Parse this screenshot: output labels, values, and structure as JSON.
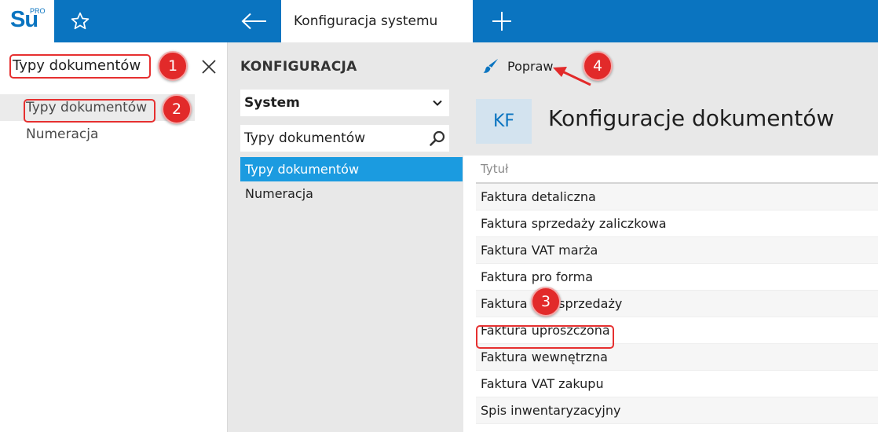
{
  "app": {
    "logo_text": "Su",
    "logo_sup": "PRO",
    "tab_title": "Konfiguracja systemu"
  },
  "search": {
    "value": "Typy dokumentów",
    "results": [
      {
        "label": "Typy dokumentów",
        "selected": true
      },
      {
        "label": "Numeracja",
        "selected": false
      }
    ]
  },
  "config": {
    "section_title": "KONFIGURACJA",
    "select_value": "System",
    "filter_value": "Typy dokumentów",
    "nav_items": [
      {
        "label": "Typy dokumentów",
        "active": true
      },
      {
        "label": "Numeracja",
        "active": false
      }
    ]
  },
  "main": {
    "edit_button_label": "Popraw",
    "badge": "KF",
    "title": "Konfiguracje dokumentów",
    "column_header": "Tytuł",
    "rows": [
      "Faktura detaliczna",
      "Faktura sprzedaży zaliczkowa",
      "Faktura VAT marża",
      "Faktura pro forma",
      "Faktura VAT sprzedaży",
      "Faktura uproszczona",
      "Faktura wewnętrzna",
      "Faktura VAT zakupu",
      "Spis inwentaryzacyjny"
    ]
  },
  "annotations": {
    "step1": "1",
    "step2": "2",
    "step3": "3",
    "step4": "4"
  },
  "colors": {
    "brand_blue": "#0a74c0",
    "selection_blue": "#1b9be0",
    "annotation_red": "#e22a2a"
  }
}
